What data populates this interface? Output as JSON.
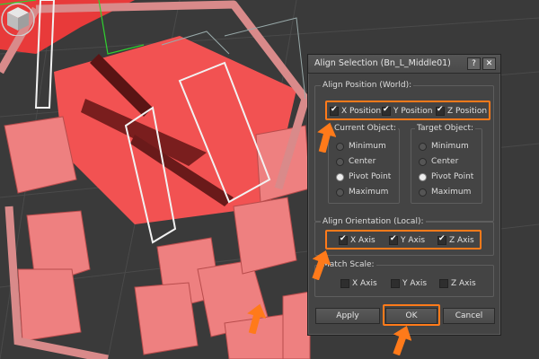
{
  "dialog": {
    "title": "Align Selection (Bn_L_Middle01)",
    "help_label": "?",
    "close_label": "✕"
  },
  "align_position": {
    "label": "Align Position (World):",
    "x": "X Position",
    "y": "Y Position",
    "z": "Z Position"
  },
  "current_object": {
    "label": "Current Object:",
    "options": [
      "Minimum",
      "Center",
      "Pivot Point",
      "Maximum"
    ],
    "selected": "Pivot Point"
  },
  "target_object": {
    "label": "Target Object:",
    "options": [
      "Minimum",
      "Center",
      "Pivot Point",
      "Maximum"
    ],
    "selected": "Pivot Point"
  },
  "align_orientation": {
    "label": "Align Orientation (Local):",
    "x": "X Axis",
    "y": "Y Axis",
    "z": "Z Axis"
  },
  "match_scale": {
    "label": "Match Scale:",
    "x": "X Axis",
    "y": "Y Axis",
    "z": "Z Axis"
  },
  "buttons": {
    "apply": "Apply",
    "ok": "OK",
    "cancel": "Cancel"
  },
  "colors": {
    "highlight": "#ff7a1a",
    "mesh": "#f05a5a",
    "viewport_bg": "#3a3a3a"
  }
}
